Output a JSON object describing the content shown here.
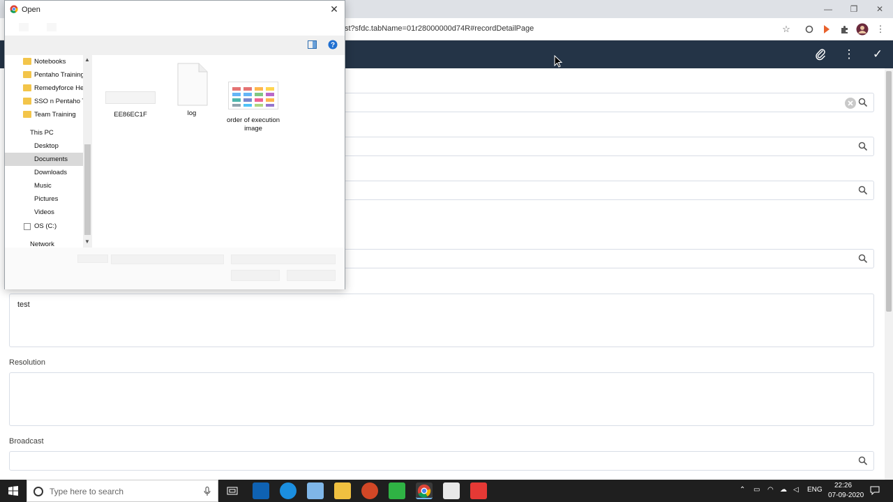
{
  "browser": {
    "url": "st?sfdc.tabName=01r28000000d74R#recordDetailPage",
    "window_buttons": {
      "minimize": "—",
      "restore": "❐",
      "close": "✕"
    }
  },
  "form": {
    "description_value": "test",
    "resolution_label": "Resolution",
    "resolution_value": "",
    "broadcast_label": "Broadcast"
  },
  "dialog": {
    "title": "Open",
    "close": "✕",
    "nav": [
      {
        "label": "Notebooks",
        "type": "folder"
      },
      {
        "label": "Pentaho Training",
        "type": "folder"
      },
      {
        "label": "Remedyforce He",
        "type": "folder"
      },
      {
        "label": "SSO n Pentaho T",
        "type": "folder"
      },
      {
        "label": "Team Training",
        "type": "folder"
      },
      {
        "label": "This PC",
        "type": "pc"
      },
      {
        "label": "Desktop",
        "type": "item"
      },
      {
        "label": "Documents",
        "type": "item",
        "selected": true
      },
      {
        "label": "Downloads",
        "type": "item"
      },
      {
        "label": "Music",
        "type": "item"
      },
      {
        "label": "Pictures",
        "type": "item"
      },
      {
        "label": "Videos",
        "type": "item"
      },
      {
        "label": "OS (C:)",
        "type": "drive"
      },
      {
        "label": "Network",
        "type": "network"
      }
    ],
    "files": [
      {
        "name": "EE86EC1F",
        "icon": "file-thumbnail-icon"
      },
      {
        "name": "log",
        "icon": "text-file-icon"
      },
      {
        "name": "order of execution image",
        "icon": "image-file-icon"
      }
    ]
  },
  "taskbar": {
    "search_placeholder": "Type here to search",
    "lang": "ENG",
    "time": "22:26",
    "date": "07-09-2020"
  },
  "colors": {
    "app_header": "#243447",
    "taskbar": "#1f1f1f"
  }
}
